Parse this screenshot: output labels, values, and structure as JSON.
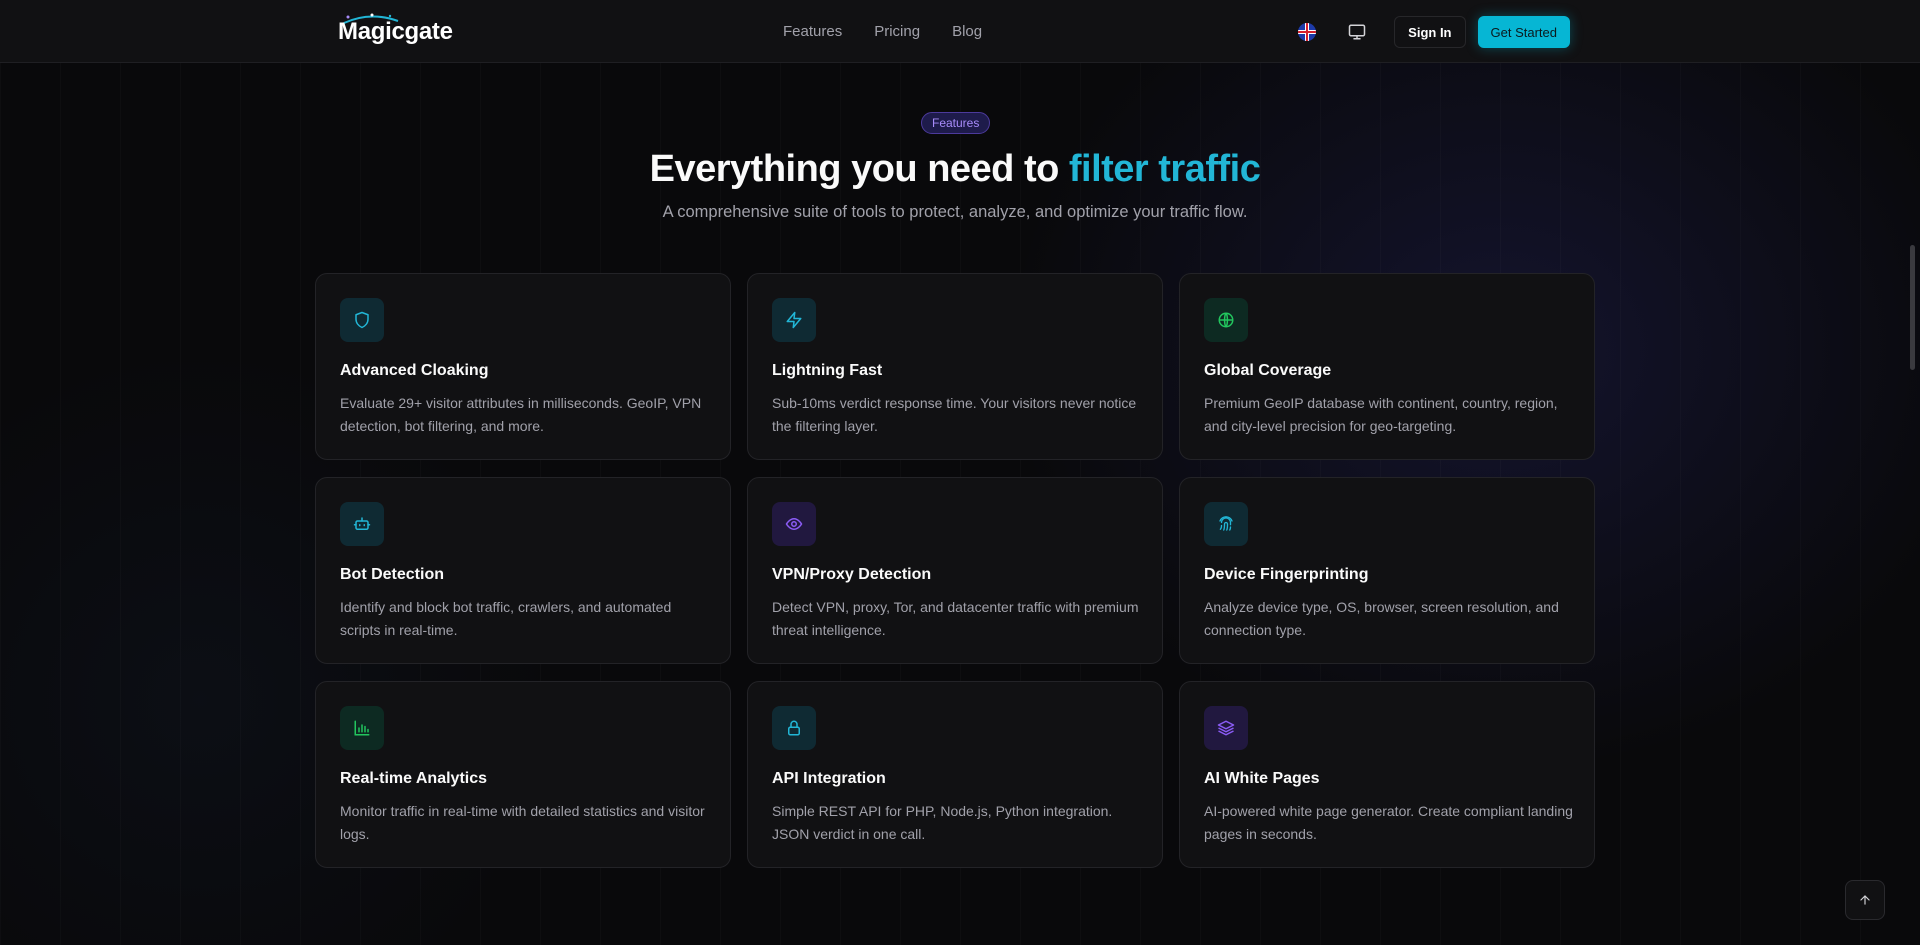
{
  "nav": {
    "logo": "Magicgate",
    "links": [
      "Features",
      "Pricing",
      "Blog"
    ],
    "sign_in": "Sign In",
    "get_started": "Get Started"
  },
  "hero": {
    "badge": "Features",
    "headline_plain": "Everything you need to ",
    "headline_accent": "filter traffic",
    "subtitle": "A comprehensive suite of tools to protect, analyze, and optimize your traffic flow."
  },
  "colors": {
    "accent_cyan": "#06b6d4",
    "accent_green": "#22c55e",
    "accent_purple": "#8b5cf6",
    "background": "#09090b"
  },
  "features": [
    {
      "title": "Advanced Cloaking",
      "desc": "Evaluate 29+ visitor attributes in milliseconds. GeoIP, VPN detection, bot filtering, and more.",
      "icon": "shield-icon"
    },
    {
      "title": "Lightning Fast",
      "desc": "Sub-10ms verdict response time. Your visitors never notice the filtering layer.",
      "icon": "lightning-icon"
    },
    {
      "title": "Global Coverage",
      "desc": "Premium GeoIP database with continent, country, region, and city-level precision for geo-targeting.",
      "icon": "globe-icon"
    },
    {
      "title": "Bot Detection",
      "desc": "Identify and block bot traffic, crawlers, and automated scripts in real-time.",
      "icon": "bot-icon"
    },
    {
      "title": "VPN/Proxy Detection",
      "desc": "Detect VPN, proxy, Tor, and datacenter traffic with premium threat intelligence.",
      "icon": "eye-icon"
    },
    {
      "title": "Device Fingerprinting",
      "desc": "Analyze device type, OS, browser, screen resolution, and connection type.",
      "icon": "fingerprint-icon"
    },
    {
      "title": "Real-time Analytics",
      "desc": "Monitor traffic in real-time with detailed statistics and visitor logs.",
      "icon": "bar-chart-icon"
    },
    {
      "title": "API Integration",
      "desc": "Simple REST API for PHP, Node.js, Python integration. JSON verdict in one call.",
      "icon": "lock-icon"
    },
    {
      "title": "AI White Pages",
      "desc": "AI-powered white page generator. Create compliant landing pages in seconds.",
      "icon": "layers-icon"
    }
  ]
}
